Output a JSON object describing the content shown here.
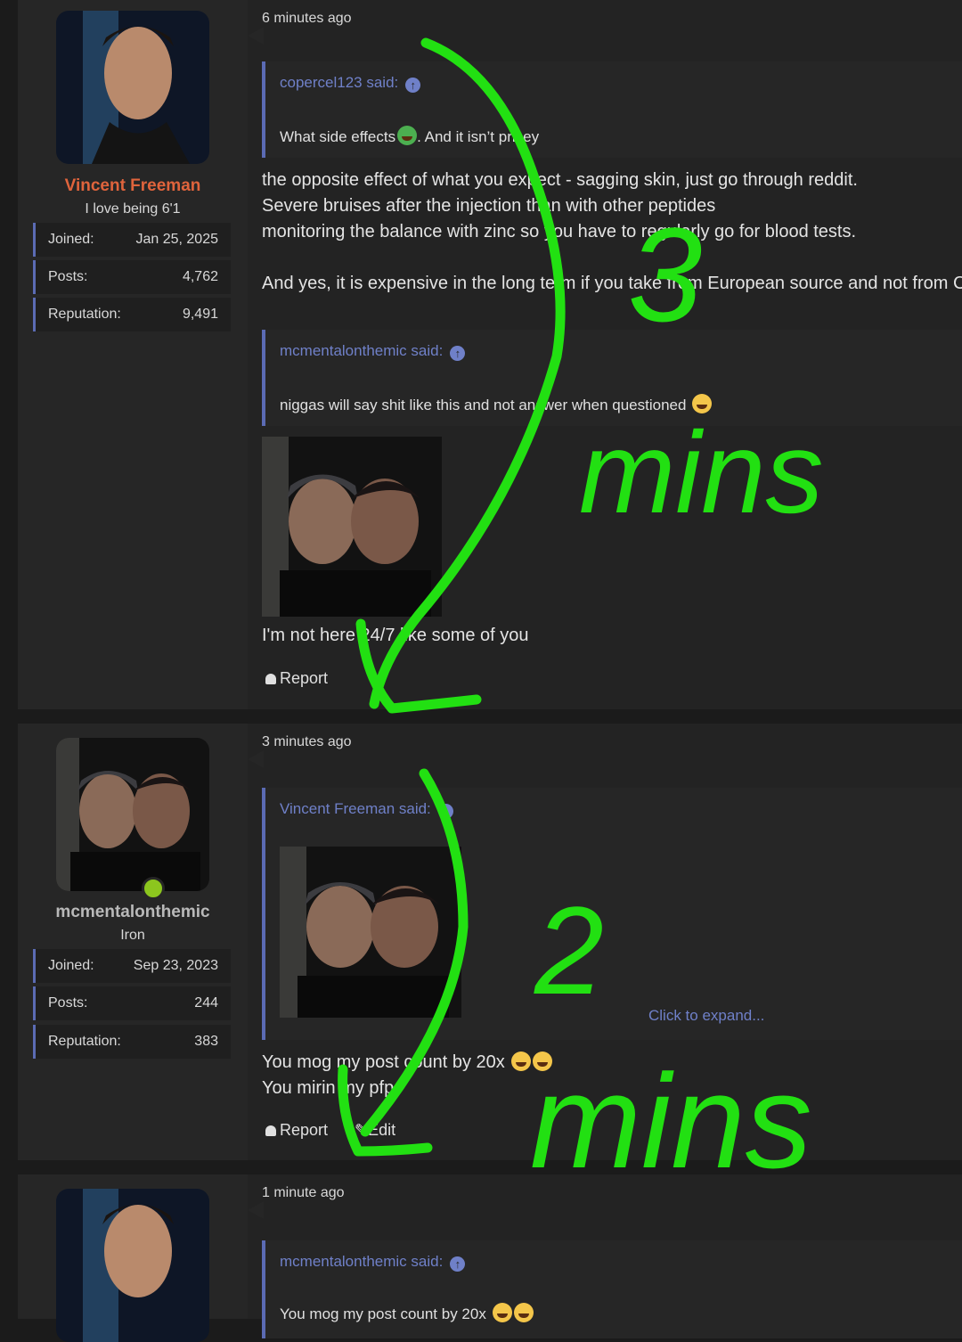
{
  "posts": [
    {
      "user": {
        "name": "Vincent Freeman",
        "title": "I love being 6'1",
        "name_color": "#e0643c",
        "stats": [
          {
            "k": "Joined:",
            "v": "Jan 25, 2025"
          },
          {
            "k": "Posts:",
            "v": "4,762"
          },
          {
            "k": "Reputation:",
            "v": "9,491"
          }
        ]
      },
      "time": "6 minutes ago",
      "quotes": [
        {
          "author": "copercel123 said:",
          "body": "What side effects",
          "body2": ". And it isn’t pricey"
        },
        {
          "author": "mcmentalonthemic said:",
          "body": "niggas will say shit like this and not answer when questioned"
        }
      ],
      "body": [
        "the opposite effect of what you expect - sagging skin, just go through reddit.",
        "Severe bruises after the injection than with other peptides",
        "monitoring the balance with zinc so you have to regularly go for blood tests.",
        "",
        "And yes, it is expensive in the long term if you take from European source and not from C"
      ],
      "caption": "I'm not here 24/7 like some of you",
      "actions": {
        "report": "Report"
      }
    },
    {
      "user": {
        "name": "mcmentalonthemic",
        "title": "Iron",
        "name_color": "#b9b9b9",
        "stats": [
          {
            "k": "Joined:",
            "v": "Sep 23, 2023"
          },
          {
            "k": "Posts:",
            "v": "244"
          },
          {
            "k": "Reputation:",
            "v": "383"
          }
        ]
      },
      "time": "3 minutes ago",
      "quote": {
        "author": "Vincent Freeman said:",
        "expand": "Click to expand..."
      },
      "body": [
        "You mog my post count by 20x",
        "You mirin my pfp"
      ],
      "actions": {
        "report": "Report",
        "edit": "Edit"
      }
    },
    {
      "time": "1 minute ago",
      "quote": {
        "author": "mcmentalonthemic said:",
        "body": "You mog my post count by 20x"
      }
    }
  ],
  "annotations": {
    "first": "3",
    "first_unit": "mins",
    "second": "2",
    "second_unit": "mins",
    "color": "#22e012"
  }
}
